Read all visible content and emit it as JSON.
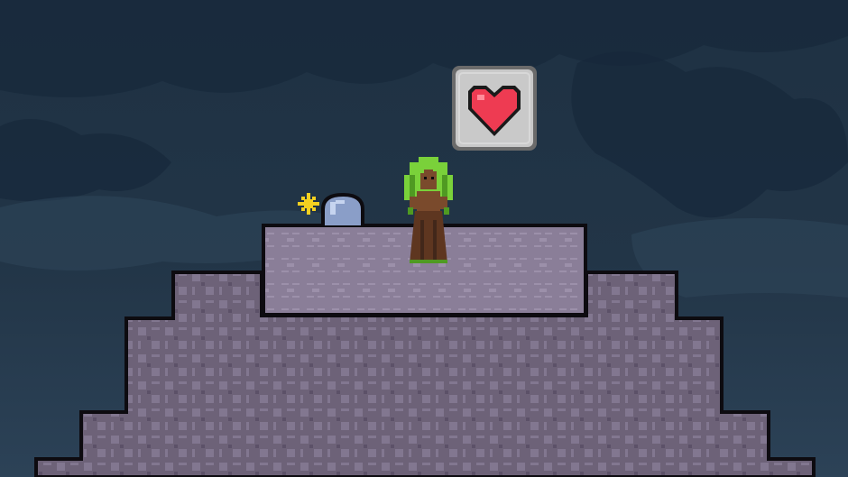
{
  "scene": {
    "type": "2d-pixel-platformer",
    "background": {
      "sky_top": "#1e3143",
      "sky_mid": "#223547",
      "sky_bottom": "#2c4257",
      "cloud_dark": "#17283a",
      "cloud_light": "#30475c"
    },
    "terrain": {
      "stone_fill": "#6d6278",
      "stone_pattern": "#827790",
      "stone_dark": "#5c5168",
      "pedestal_fill": "#8a7e98",
      "pedestal_pattern": "#9c90aa",
      "outline": "#0d0b10"
    },
    "characters": [
      {
        "name": "Dryad",
        "role": "npc",
        "hair_color": "#7ad13a",
        "hair_shade": "#4f9a22",
        "skin_color": "#7a4a2c",
        "dress_color": "#5e3620"
      }
    ],
    "objects": [
      {
        "name": "gravestone",
        "fill": "#8a9ec8",
        "highlight": "#c6d4ef"
      },
      {
        "name": "sparkle",
        "color": "#f4d020"
      }
    ],
    "emote_bubble": {
      "icon": "heart-icon",
      "frame_color": "#c9c9c9",
      "frame_border": "#6b6b6b",
      "heart_color": "#ee3b52",
      "heart_outline": "#1a1a1a"
    }
  }
}
